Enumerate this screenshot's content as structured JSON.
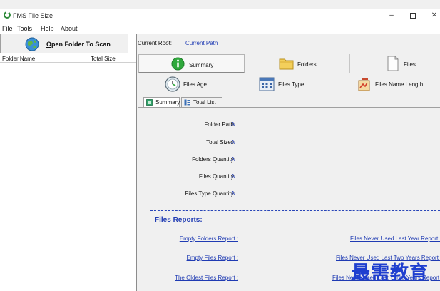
{
  "window": {
    "title": "FMS File Size",
    "minimize": "–",
    "close": "✕"
  },
  "menu": [
    "File",
    "Tools",
    "Help",
    "About"
  ],
  "left_pane": {
    "open_button_label": "Open Folder To Scan",
    "columns": [
      "Folder Name",
      "Total Size"
    ]
  },
  "current_root": {
    "label": "Current Root:",
    "value": "Current Path"
  },
  "top_tabs": [
    {
      "label": "Summary",
      "icon": "info-icon",
      "selected": true
    },
    {
      "label": "Folders",
      "icon": "folder-icon",
      "selected": false
    },
    {
      "label": "Files",
      "icon": "file-icon",
      "selected": false
    }
  ],
  "sub_tabs": [
    {
      "label": "Files Age",
      "icon": "clock-icon"
    },
    {
      "label": "Files Type",
      "icon": "file-types-icon"
    },
    {
      "label": "Files Name Length",
      "icon": "name-length-icon"
    }
  ],
  "inner_tabs": [
    {
      "label": "Summary",
      "icon": "summary-icon",
      "selected": true
    },
    {
      "label": "Total List",
      "icon": "list-icon",
      "selected": false
    }
  ],
  "summary_fields": [
    {
      "label": "Folder Path:",
      "value": "A"
    },
    {
      "label": "Total Sizes:",
      "value": "A"
    },
    {
      "label": "Folders Quantity:",
      "value": "A"
    },
    {
      "label": "Files Quantity:",
      "value": "A"
    },
    {
      "label": "Files Type Quantity:",
      "value": "A"
    }
  ],
  "reports": {
    "title": "Files Reports:",
    "left": [
      "Empty Folders Report :",
      "Empty Files Report :",
      "The Oldest Files Report :"
    ],
    "right": [
      "Files Never Used Last Year Report :",
      "Files Never Used Last Two Years Report :",
      "Files Never Used Last Three Years Report :"
    ]
  },
  "watermark": "最需教育",
  "colors": {
    "link": "#1f3bb3",
    "accent_green": "#2f8a3a",
    "window_bg": "#f0f0f0"
  }
}
